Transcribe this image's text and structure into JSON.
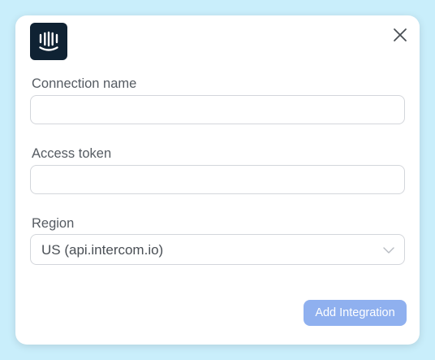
{
  "dialog": {
    "logo_icon": "intercom-logo-icon",
    "close_icon": "close-icon",
    "colors": {
      "backdrop": "#c9eefb",
      "logo_bg": "#0f2233",
      "primary_button": "#8fb0ef"
    }
  },
  "form": {
    "connection_name_label": "Connection name",
    "connection_name_value": "",
    "access_token_label": "Access token",
    "access_token_value": "",
    "region_label": "Region",
    "region_selected": "US (api.intercom.io)"
  },
  "actions": {
    "add_integration_label": "Add Integration"
  }
}
